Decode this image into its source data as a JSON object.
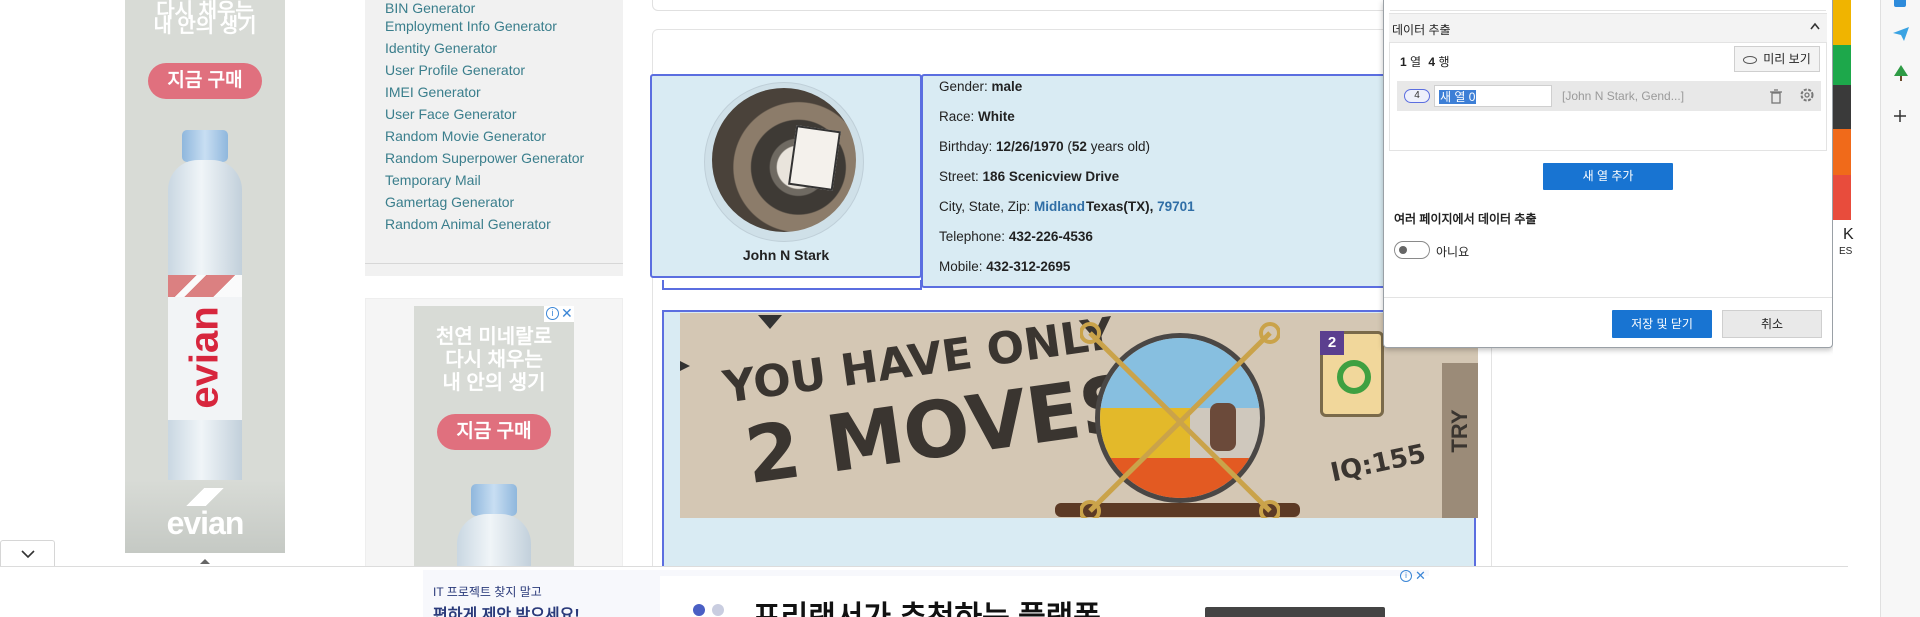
{
  "ad_left": {
    "headline_line1": "다시 채우는",
    "headline_line2": "내 안의 생기",
    "cta": "지금 구매",
    "brand": "evian",
    "brand_footer": "evian"
  },
  "sidebar": {
    "items": [
      {
        "label": "BIN Generator"
      },
      {
        "label": "Employment Info Generator"
      },
      {
        "label": "Identity Generator"
      },
      {
        "label": "User Profile Generator"
      },
      {
        "label": "IMEI Generator"
      },
      {
        "label": "User Face Generator"
      },
      {
        "label": "Random Movie Generator"
      },
      {
        "label": "Random Superpower Generator"
      },
      {
        "label": "Temporary Mail"
      },
      {
        "label": "Gamertag Generator"
      },
      {
        "label": "Random Animal Generator"
      }
    ]
  },
  "ad_mid": {
    "line1": "천연 미네랄로",
    "line2": "다시 채우는",
    "line3": "내 안의 생기",
    "cta": "지금 구매"
  },
  "profile": {
    "name": "John N Stark",
    "gender_label": "Gender:",
    "gender": "male",
    "race_label": "Race:",
    "race": "White",
    "birthday_label": "Birthday:",
    "birthday": "12/26/1970",
    "age_open": "(",
    "age": "52",
    "age_suffix": "years old)",
    "street_label": "Street:",
    "street": "186 Scenicview Drive",
    "city_label": "City, State, Zip:",
    "city": "Midland",
    "state": "Texas(TX),",
    "zip": "79701",
    "telephone_label": "Telephone:",
    "telephone": "432-226-4536",
    "mobile_label": "Mobile:",
    "mobile": "432-312-2695"
  },
  "game_ad": {
    "line1": "YOU HAVE ONLY",
    "line2": "2 MOVES",
    "iq": "IQ:155",
    "card_number": "2",
    "try": "TRY"
  },
  "panel": {
    "section_title": "데이터 추출",
    "cols_count": "1",
    "cols_label": "열",
    "rows_count": "4",
    "rows_label": "행",
    "preview_button": "미리 보기",
    "column_index": "4",
    "column_name_value": "새 열 0",
    "column_preview": "[John N Stark, Gend...]",
    "add_column_button": "새 열 추가",
    "multi_page_label": "여러 페이지에서 데이터 추출",
    "toggle_label": "아니요",
    "save_button": "저장 및 닫기",
    "cancel_button": "취소"
  },
  "right_strip": {
    "letter_k": "K",
    "label_es": "ES"
  },
  "bottom_ad": {
    "small_line1": "IT 프로젝트 찾지 말고",
    "small_line2": "편하게 제안 받으세요!",
    "headline": "프리랜서가 추천하는 플랫폼"
  },
  "colors": {
    "accent_blue": "#1874d2",
    "selection_border": "#5b6ee0",
    "info_bg": "#d9ebf3",
    "link": "#3a7e8c"
  }
}
